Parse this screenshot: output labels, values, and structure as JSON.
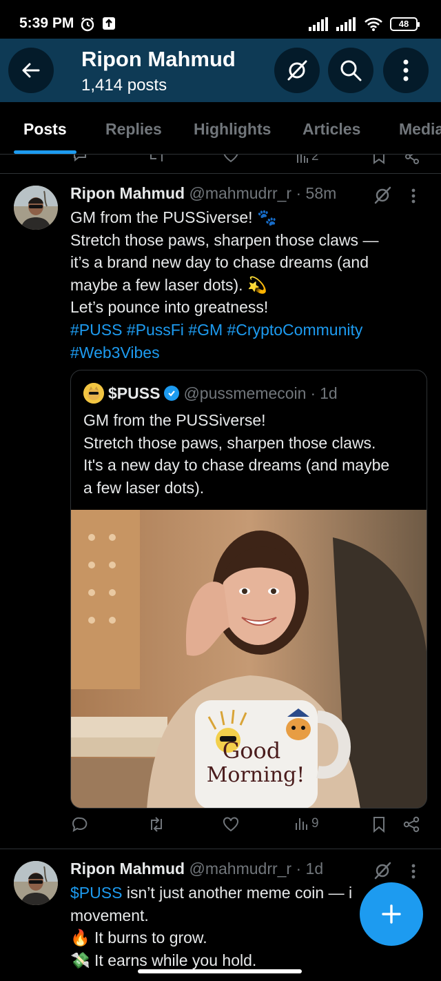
{
  "status_bar": {
    "time": "5:39 PM",
    "battery": "48"
  },
  "header": {
    "name": "Ripon Mahmud",
    "post_count": "1,414 posts"
  },
  "tabs": [
    {
      "label": "Posts",
      "active": true
    },
    {
      "label": "Replies",
      "active": false
    },
    {
      "label": "Highlights",
      "active": false
    },
    {
      "label": "Articles",
      "active": false
    },
    {
      "label": "Media",
      "active": false
    }
  ],
  "posts": [
    {
      "author": "Ripon Mahmud",
      "handle": "@mahmudrr_r",
      "time": "58m",
      "lines": [
        "GM from the PUSSiverse! 🐾",
        "Stretch those paws, sharpen those claws —",
        "it’s a brand new day to chase dreams (and",
        "maybe a few laser dots). 💫",
        "Let’s pounce into greatness!"
      ],
      "hashtags_line1": "#PUSS #PussFi #GM #CryptoCommunity",
      "hashtags_line2": "#Web3Vibes",
      "quote": {
        "author": "$PUSS",
        "handle": "@pussmemecoin",
        "time": "1d",
        "lines": [
          "GM from the PUSSiverse!",
          "Stretch those paws, sharpen those claws.",
          "It's a new day to chase dreams (and maybe",
          "a few laser dots)."
        ],
        "image_caption_line1": "Good",
        "image_caption_line2": "Morning!"
      },
      "views": "9"
    },
    {
      "author": "Ripon Mahmud",
      "handle": "@mahmudrr_r",
      "time": "1d",
      "line1_link": "$PUSS",
      "line1_rest": " isn’t just another meme coin — i",
      "line2": "movement.",
      "line3": "🔥 It burns to grow.",
      "line4": "💸 It earns while you hold."
    }
  ],
  "prev_post": {
    "views": "2"
  },
  "colors": {
    "accent": "#1d9bf0",
    "header_bg": "#0e3a55",
    "background": "#000000",
    "secondary_text": "#71767b"
  },
  "icons": [
    "back-arrow-icon",
    "grok-icon",
    "search-icon",
    "more-vertical-icon",
    "reply-icon",
    "repost-icon",
    "like-icon",
    "views-icon",
    "bookmark-icon",
    "share-icon",
    "plus-icon",
    "verified-icon"
  ]
}
